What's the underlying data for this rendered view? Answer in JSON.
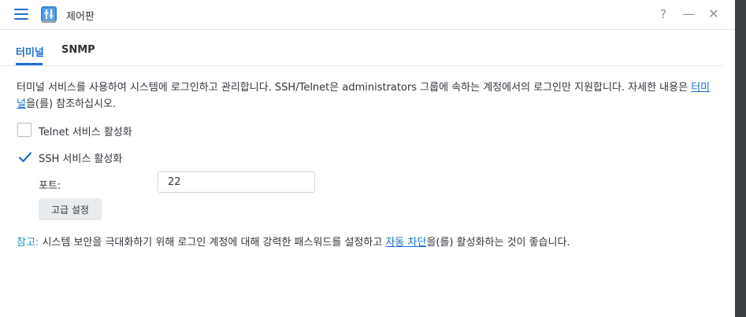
{
  "window": {
    "title": "제어판",
    "help_icon": "?",
    "minimize_icon": "—",
    "close_icon": "✕"
  },
  "tabs": [
    {
      "label": "터미널",
      "active": true
    },
    {
      "label": "SNMP",
      "active": false
    }
  ],
  "description": {
    "text": "터미널 서비스를 사용하여 시스템에 로그인하고 관리합니다. SSH/Telnet은 administrators 그룹에 속하는 계정에서의 로그인만 지원합니다. 자세한 내용은 ",
    "link": "터미널",
    "suffix": "을(를) 참조하십시오."
  },
  "options": [
    {
      "label": "Telnet 서비스 활성화",
      "checked": false
    },
    {
      "label": "SSH 서비스 활성화",
      "checked": true
    }
  ],
  "port": {
    "label": "포트:",
    "value": "22"
  },
  "advanced_button": "고급 설정",
  "note": {
    "prefix": "참고:",
    "text": " 시스템 보안을 극대화하기 위해 로그인 계정에 대해 강력한 패스워드를 설정하고 ",
    "link": "자동 차단",
    "suffix": "을(를) 활성화하는 것이 좋습니다."
  },
  "colors": {
    "accent": "#1e6fcf",
    "note_prefix": "#1e90c8",
    "link": "#1a6fd1"
  }
}
